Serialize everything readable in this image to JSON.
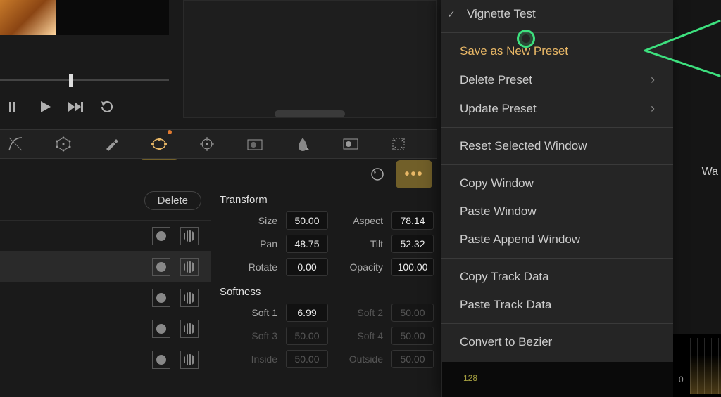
{
  "preview": {
    "caption": ""
  },
  "playback": {
    "prev": "prev",
    "play": "play",
    "next": "next",
    "loop": "loop"
  },
  "tools": [
    "curves",
    "nodes",
    "picker",
    "window",
    "tracker",
    "gallery",
    "blur",
    "key",
    "sizing"
  ],
  "window_panel": {
    "delete_label": "Delete",
    "rows": [
      {
        "selected": false
      },
      {
        "selected": true
      },
      {
        "selected": false
      },
      {
        "selected": false
      },
      {
        "selected": false
      }
    ]
  },
  "transform": {
    "title": "Transform",
    "size_label": "Size",
    "size_value": "50.00",
    "aspect_label": "Aspect",
    "aspect_value": "78.14",
    "pan_label": "Pan",
    "pan_value": "48.75",
    "tilt_label": "Tilt",
    "tilt_value": "52.32",
    "rotate_label": "Rotate",
    "rotate_value": "0.00",
    "opacity_label": "Opacity",
    "opacity_value": "100.00"
  },
  "softness": {
    "title": "Softness",
    "soft1_label": "Soft 1",
    "soft1_value": "6.99",
    "soft2_label": "Soft 2",
    "soft2_value": "50.00",
    "soft3_label": "Soft 3",
    "soft3_value": "50.00",
    "soft4_label": "Soft 4",
    "soft4_value": "50.00",
    "inside_label": "Inside",
    "inside_value": "50.00",
    "outside_label": "Outside",
    "outside_value": "50.00"
  },
  "context_menu": {
    "checked_preset": "Vignette Test",
    "save_new": "Save as New Preset",
    "delete_preset": "Delete Preset",
    "update_preset": "Update Preset",
    "reset_window": "Reset Selected Window",
    "copy_window": "Copy Window",
    "paste_window": "Paste Window",
    "paste_append": "Paste Append Window",
    "copy_track": "Copy Track Data",
    "paste_track": "Paste Track Data",
    "convert_bezier": "Convert to Bezier"
  },
  "scopes": {
    "label": "Wa",
    "zero": "0",
    "tick": "128"
  }
}
